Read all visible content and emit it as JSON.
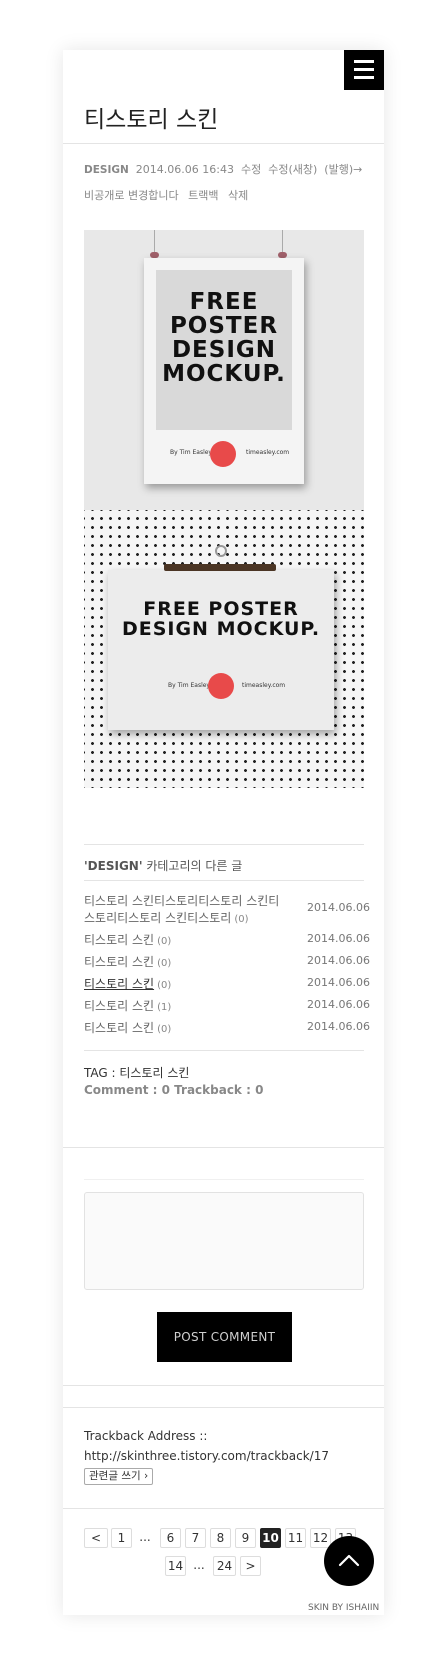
{
  "header": {
    "menu_icon": "hamburger-icon",
    "title": "티스토리 스킨"
  },
  "meta": {
    "category": "DESIGN",
    "datetime": "2014.06.06 16:43",
    "edit": "수정",
    "edit_new": "수정(새창)",
    "publish": "(발행)",
    "arrow": "→",
    "private": "비공개로 변경합니다",
    "trackback": "트랙백",
    "delete": "삭제"
  },
  "images": [
    {
      "title": "FREE POSTER DESIGN MOCKUP",
      "lines": [
        "FREE",
        "POSTER",
        "DESIGN",
        "MOCKUP."
      ],
      "byline": "By Tim Easley",
      "site": "timeasley.com",
      "badge": "Tim Easley"
    },
    {
      "title": "FREE POSTER DESIGN MOCKUP",
      "lines": [
        "FREE POSTER",
        "DESIGN MOCKUP."
      ],
      "byline": "By Tim Easley",
      "site": "timeasley.com",
      "badge": "Tim Easley"
    }
  ],
  "related": {
    "category": "'DESIGN'",
    "heading_suffix": " 카테고리의 다른 글",
    "items": [
      {
        "title": "티스토리 스킨티스토리티스토리 스킨티스토리티스토리 스킨티스토리",
        "count": "(0)",
        "date": "2014.06.06"
      },
      {
        "title": "티스토리 스킨",
        "count": "(0)",
        "date": "2014.06.06"
      },
      {
        "title": "티스토리 스킨",
        "count": "(0)",
        "date": "2014.06.06"
      },
      {
        "title": "티스토리 스킨",
        "count": "(0)",
        "date": "2014.06.06"
      },
      {
        "title": "티스토리 스킨",
        "count": "(1)",
        "date": "2014.06.06"
      },
      {
        "title": "티스토리 스킨",
        "count": "(0)",
        "date": "2014.06.06"
      }
    ]
  },
  "tag": {
    "label": "TAG : ",
    "value": "티스토리 스킨"
  },
  "counts": "Comment : 0 Trackback : 0",
  "comment": {
    "placeholder": "",
    "submit_label": "POST COMMENT"
  },
  "trackback": {
    "label": "Trackback Address ::",
    "url": "http://skinthree.tistory.com/trackback/17",
    "related_button": "관련글 쓰기 ›"
  },
  "pagination": {
    "prev": "<",
    "next": ">",
    "pages": [
      "1",
      "...",
      "6",
      "7",
      "8",
      "9",
      "10",
      "11",
      "12",
      "13",
      "14",
      "...",
      "24"
    ],
    "current": "10"
  },
  "scroll_top_icon": "chevron-up-icon",
  "footer": {
    "skin_credit": "SKIN BY ISHAIIN"
  }
}
